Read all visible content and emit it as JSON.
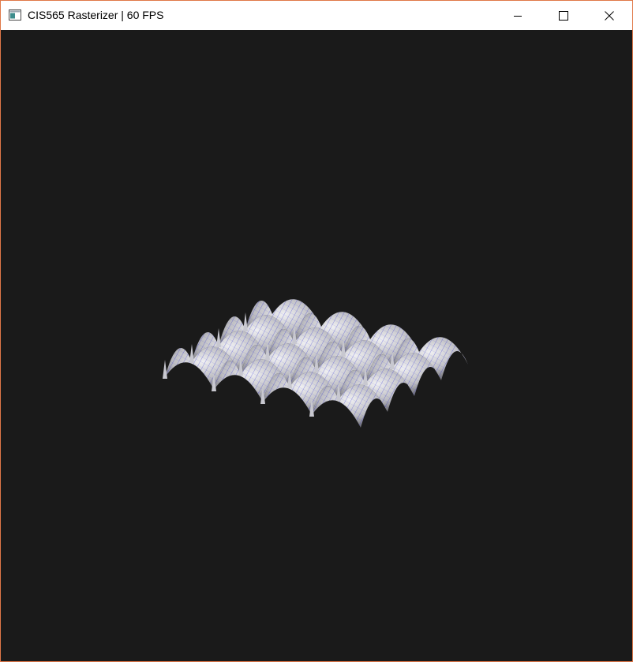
{
  "window": {
    "title": "CIS565 Rasterizer | 60 FPS",
    "app_icon": "console-window-icon",
    "controls": {
      "minimize_icon": "minimize-icon",
      "maximize_icon": "maximize-icon",
      "close_icon": "close-icon"
    },
    "border_color": "#e07848"
  },
  "viewport": {
    "background_color": "#1a1a1a",
    "content": "rendered-3d-surface",
    "surface_color": "#d8d8dc",
    "wireframe_color": "#1a1ad0"
  }
}
